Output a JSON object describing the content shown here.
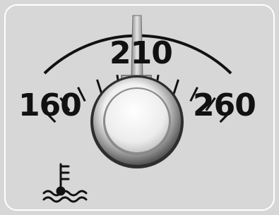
{
  "gauge": {
    "type": "engine-coolant-temperature",
    "scale": {
      "min_label": "160",
      "mid_label": "210",
      "max_label": "260"
    },
    "reading_fraction": 0.5,
    "icon": "coolant-temperature-icon"
  },
  "colors": {
    "background": "#d7d7d7",
    "ink": "#111111",
    "needle": "#c9c9c9",
    "hub": "#bfbfbf"
  }
}
